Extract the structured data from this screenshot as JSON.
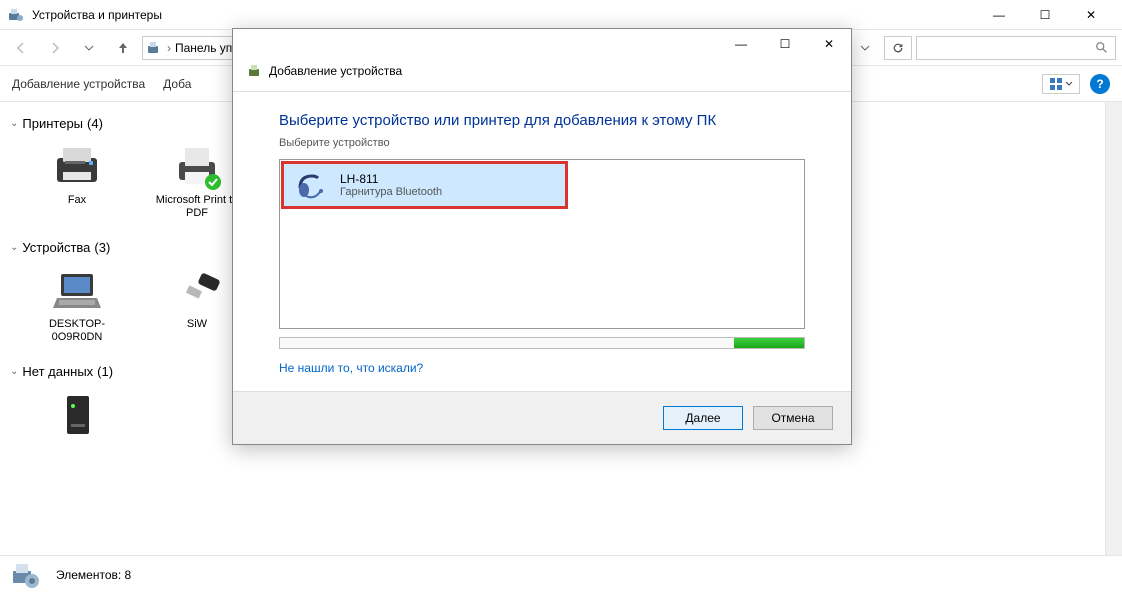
{
  "window": {
    "title": "Устройства и принтеры",
    "minimize": "—",
    "maximize": "☐",
    "close": "✕"
  },
  "nav": {
    "breadcrumb_prefix": "Панель упр",
    "refresh": "↻",
    "search_placeholder": "",
    "search_icon": "🔍"
  },
  "toolbar": {
    "add_device": "Добавление устройства",
    "add_short": "Доба",
    "view_icon": "▦",
    "help": "?"
  },
  "groups": {
    "printers": {
      "label": "Принтеры",
      "count": "(4)"
    },
    "devices": {
      "label": "Устройства",
      "count": "(3)"
    },
    "nodata": {
      "label": "Нет данных",
      "count": "(1)"
    }
  },
  "items": {
    "fax": "Fax",
    "ms_print": "Microsoft Print to PDF",
    "desktop": "DESKTOP-0O9R0DN",
    "siw": "SiW"
  },
  "statusbar": {
    "elements_label": "Элементов:",
    "elements_count": "8"
  },
  "dialog": {
    "title": "Добавление устройства",
    "heading": "Выберите устройство или принтер для добавления к этому ПК",
    "subheading": "Выберите устройство",
    "device_name": "LH-811",
    "device_type": "Гарнитура Bluetooth",
    "not_found_link": "Не нашли то, что искали?",
    "next": "Далее",
    "cancel": "Отмена",
    "minimize": "—",
    "maximize": "☐",
    "close": "✕"
  }
}
